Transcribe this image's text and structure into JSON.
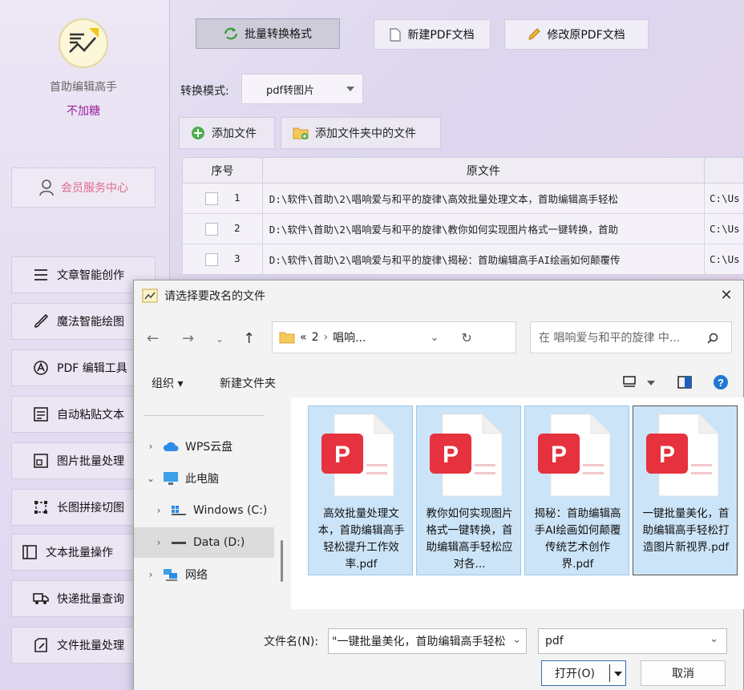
{
  "app": {
    "name": "首助编辑高手",
    "user": "不加糖",
    "vip_label": "会员服务中心"
  },
  "sidebar": {
    "items": [
      {
        "label": "文章智能创作",
        "icon": "menu-lines-icon"
      },
      {
        "label": "魔法智能绘图",
        "icon": "brush-icon"
      },
      {
        "label": "PDF 编辑工具",
        "icon": "pdf-icon"
      },
      {
        "label": "自动粘贴文本",
        "icon": "document-icon"
      },
      {
        "label": "图片批量处理",
        "icon": "image-icon"
      },
      {
        "label": "长图拼接切图",
        "icon": "crop-icon"
      },
      {
        "label": "文本批量操作",
        "icon": "text-icon"
      },
      {
        "label": "快递批量查询",
        "icon": "truck-icon"
      },
      {
        "label": "文件批量处理",
        "icon": "file-edit-icon"
      }
    ]
  },
  "toolbar": {
    "batch_convert": "批量转换格式",
    "new_pdf": "新建PDF文档",
    "edit_pdf": "修改原PDF文档"
  },
  "mode": {
    "label": "转换模式:",
    "value": "pdf转图片"
  },
  "add": {
    "add_file": "添加文件",
    "add_folder": "添加文件夹中的文件"
  },
  "table": {
    "headers": [
      "序号",
      "原文件"
    ],
    "rows": [
      {
        "index": "1",
        "path": "D:\\软件\\首助\\2\\唱响爱与和平的旋律\\高效批量处理文本，首助编辑高手轻松",
        "out": "C:\\Us"
      },
      {
        "index": "2",
        "path": "D:\\软件\\首助\\2\\唱响爱与和平的旋律\\教你如何实现图片格式一键转换，首助",
        "out": "C:\\Us"
      },
      {
        "index": "3",
        "path": "D:\\软件\\首助\\2\\唱响爱与和平的旋律\\揭秘：首助编辑高手AI绘画如何颠覆传",
        "out": "C:\\Us"
      }
    ]
  },
  "dialog": {
    "title": "请选择要改名的文件",
    "address": {
      "prefix": "«",
      "seg1": "2",
      "seg2": "唱响..."
    },
    "search_placeholder": "在 唱响爱与和平的旋律 中...",
    "organize": "组织 ▾",
    "new_folder": "新建文件夹",
    "tree": [
      {
        "label": "WPS云盘",
        "expanded": false
      },
      {
        "label": "此电脑",
        "expanded": true
      },
      {
        "label": "Windows (C:)",
        "expanded": false
      },
      {
        "label": "Data (D:)",
        "expanded": false,
        "selected": true
      },
      {
        "label": "网络",
        "expanded": false
      }
    ],
    "files": [
      {
        "name": "高效批量处理文本，首助编辑高手轻松提升工作效率.pdf"
      },
      {
        "name": "教你如何实现图片格式一键转换，首助编辑高手轻松应对各..."
      },
      {
        "name": "揭秘：首助编辑高手AI绘画如何颠覆传统艺术创作界.pdf"
      },
      {
        "name": "一键批量美化，首助编辑高手轻松打造图片新视界.pdf"
      }
    ],
    "filename_label": "文件名(N):",
    "filename_value": "\"一键批量美化，首助编辑高手轻松",
    "filetype": "pdf",
    "open": "打开(O)",
    "cancel": "取消"
  },
  "colors": {
    "accent": "#a020a0",
    "vip": "#e06a8a",
    "pdf_red": "#e5323e",
    "selection": "#cce4f7"
  }
}
